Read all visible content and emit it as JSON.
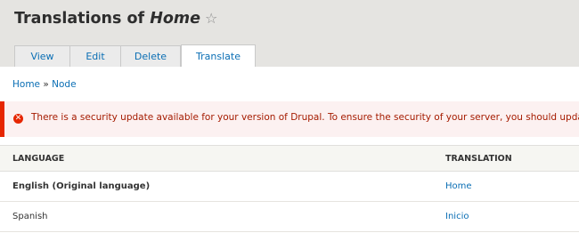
{
  "page": {
    "title_prefix": "Translations of ",
    "title_node": "Home",
    "star_icon": "☆"
  },
  "tabs": [
    {
      "label": "View",
      "active": false
    },
    {
      "label": "Edit",
      "active": false
    },
    {
      "label": "Delete",
      "active": false
    },
    {
      "label": "Translate",
      "active": true
    }
  ],
  "breadcrumb": {
    "items": [
      "Home",
      "Node"
    ],
    "separator": " » "
  },
  "message": {
    "type": "error",
    "icon": "error-circle-icon",
    "text": "There is a security update available for your version of Drupal. To ensure the security of your server, you should update immedi"
  },
  "table": {
    "headers": [
      "LANGUAGE",
      "TRANSLATION"
    ],
    "rows": [
      {
        "language": "English (Original language)",
        "translation": "Home",
        "original": true
      },
      {
        "language": "Spanish",
        "translation": "Inicio",
        "original": false
      }
    ]
  },
  "colors": {
    "link": "#0a6eb4",
    "error": "#e62600",
    "header_bg": "#e5e4e1"
  }
}
